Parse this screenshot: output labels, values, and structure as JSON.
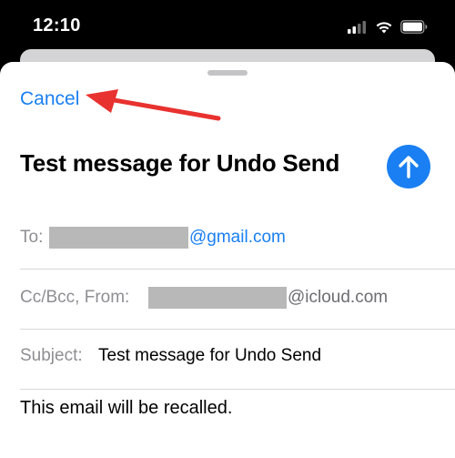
{
  "status_bar": {
    "time": "12:10"
  },
  "compose": {
    "cancel_label": "Cancel",
    "title": "Test message for Undo Send",
    "fields": {
      "to_label": "To:",
      "to_domain": "@gmail.com",
      "cc_label": "Cc/Bcc, From:",
      "from_domain": "@icloud.com",
      "subject_label": "Subject:",
      "subject_value": "Test message for Undo Send"
    },
    "body": "This email will be recalled."
  },
  "colors": {
    "accent": "#1a7ff2",
    "annotation_arrow": "#e8322f",
    "label_gray": "#8e8e93"
  },
  "icons": [
    "cellular-signal-icon",
    "wifi-icon",
    "battery-icon",
    "send-arrow-up-icon",
    "annotation-arrow-icon"
  ]
}
